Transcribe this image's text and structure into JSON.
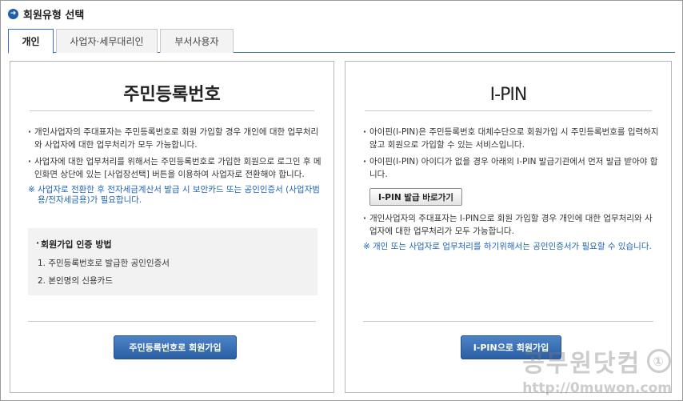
{
  "page": {
    "title": "회원유형 선택",
    "title_icon": "arrow-right-circle-icon"
  },
  "tabs": [
    {
      "label": "개인",
      "active": true
    },
    {
      "label": "사업자·세무대리인",
      "active": false
    },
    {
      "label": "부서사용자",
      "active": false
    }
  ],
  "left_panel": {
    "heading": "주민등록번호",
    "bullets": [
      "개인사업자의 주대표자는 주민등록번호로 회원 가입할 경우 개인에 대한 업무처리와 사업자에 대한 업무처리가 모두 가능합니다.",
      "사업자에 대한 업무처리를 위해서는 주민등록번호로 가입한 회원으로 로그인 후 메인화면 상단에 있는 [사업장선택] 버튼을 이용하여 사업자로 전환해야 합니다."
    ],
    "note_mark": "※",
    "note": "사업자로 전환한 후 전자세금계산서 발급 시 보안카드 또는 공인인증서 (사업자범용/전자세금용)가 필요합니다.",
    "cert": {
      "title": "회원가입 인증 방법",
      "items": [
        "1. 주민등록번호로 발급한 공인인증서",
        "2. 본인명의 신용카드"
      ]
    },
    "button": "주민등록번호로 회원가입"
  },
  "right_panel": {
    "heading": "I-PIN",
    "bullets": [
      "아이핀(I-PIN)은 주민등록번호 대체수단으로 회원가입 시 주민등록번호를 입력하지 않고 회원으로 가입할 수 있는 서비스입니다.",
      "아이핀(I-PIN) 아이디가 없을 경우 아래의 I-PIN 발급기관에서 먼저 발급 받아야 합니다.",
      "개인사업자의 주대표자는 I-PIN으로 회원 가입할 경우 개인에 대한 업무처리와 사업자에 대한 업무처리가 모두 가능합니다."
    ],
    "issue_button": "I-PIN 발급 바로가기",
    "note_mark": "※",
    "note": "개인 또는 사업자로 업무처리를 하기위해서는 공인인증서가 필요할 수 있습니다.",
    "button": "I-PIN으로 회원가입"
  },
  "watermark": {
    "text": "공무원닷컴",
    "badge": "①",
    "url": "http://0muwon.com"
  }
}
